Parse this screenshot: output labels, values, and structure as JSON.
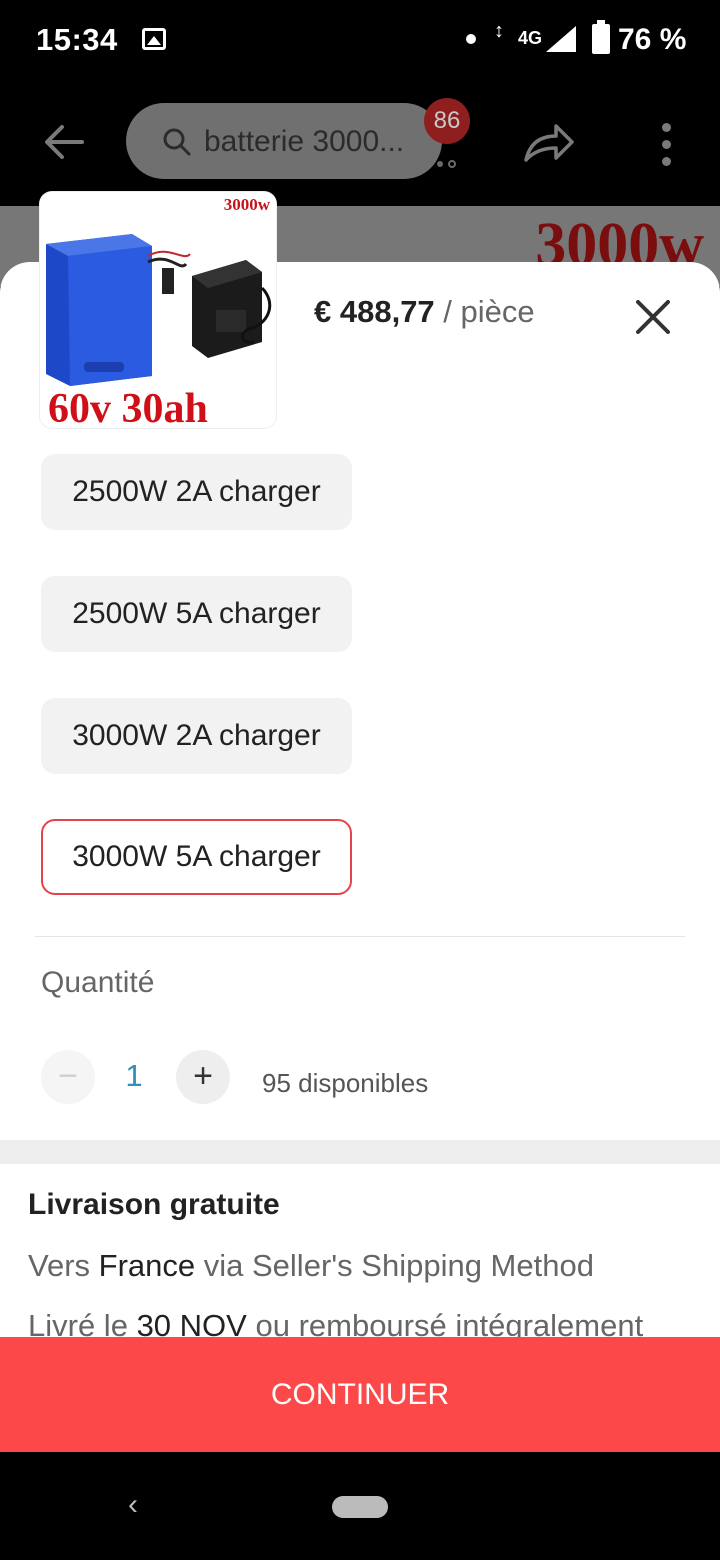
{
  "status_bar": {
    "time": "15:34",
    "network": "4G",
    "battery": "76 %"
  },
  "header": {
    "search_text": "batterie 3000...",
    "cart_count": "86"
  },
  "banner": {
    "text": "3000w"
  },
  "product": {
    "image_top_text": "3000w",
    "image_bottom_text": "60v  30ah",
    "price": "€ 488,77",
    "price_unit": "/ pièce"
  },
  "options": [
    {
      "label": "2500W 2A charger",
      "selected": false
    },
    {
      "label": "2500W 5A charger",
      "selected": false
    },
    {
      "label": "3000W 2A charger",
      "selected": false
    },
    {
      "label": "3000W 5A charger",
      "selected": true
    }
  ],
  "quantity": {
    "label": "Quantité",
    "minus": "−",
    "value": "1",
    "plus": "+",
    "stock": "95 disponibles"
  },
  "shipping": {
    "title": "Livraison gratuite",
    "to_prefix": "Vers",
    "to_country": "France",
    "via_text": "via Seller's Shipping Method",
    "delivery_prefix": "Livré le",
    "delivery_date": "30 NOV",
    "delivery_suffix": "ou remboursé intégralement"
  },
  "actions": {
    "continue_label": "CONTINUER"
  },
  "colors": {
    "accent": "#fc4848",
    "selected_border": "#e8434a",
    "qty_value": "#2f8fbd"
  },
  "icons": {
    "status": [
      "image-icon",
      "signal-icon",
      "battery-icon"
    ],
    "header": [
      "back-arrow-icon",
      "search-icon",
      "cart-icon",
      "share-icon",
      "more-vertical-icon"
    ],
    "sheet": [
      "close-icon"
    ]
  }
}
